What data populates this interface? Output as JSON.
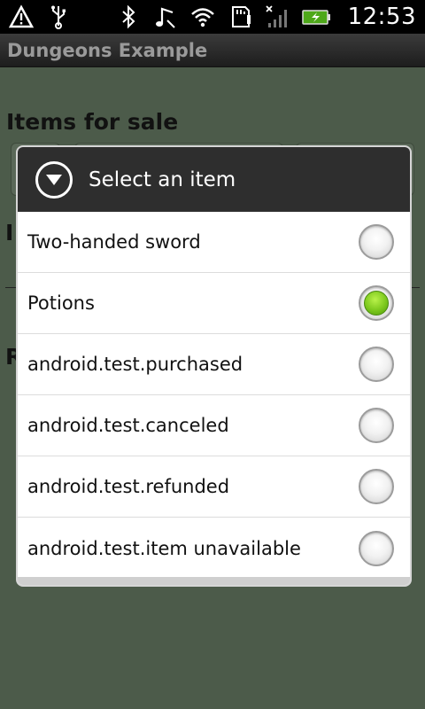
{
  "status_bar": {
    "icons_left": [
      "warning-icon",
      "usb-icon"
    ],
    "icons_right": [
      "bluetooth-icon",
      "music-icon",
      "wifi-icon",
      "sd-card-icon",
      "signal-icon",
      "battery-charging-icon"
    ],
    "time": "12:53"
  },
  "app": {
    "title": "Dungeons Example"
  },
  "background": {
    "heading": "Items for sale",
    "partial_letter_1": "I",
    "partial_letter_2": "R"
  },
  "dialog": {
    "title": "Select an item",
    "icon": "dropdown-circle-icon",
    "items": [
      {
        "label": "Two-handed sword",
        "selected": false
      },
      {
        "label": "Potions",
        "selected": true
      },
      {
        "label": "android.test.purchased",
        "selected": false
      },
      {
        "label": "android.test.canceled",
        "selected": false
      },
      {
        "label": "android.test.refunded",
        "selected": false
      },
      {
        "label": "android.test.item unavailable",
        "selected": false
      }
    ]
  },
  "colors": {
    "background": "#4c5b4a",
    "dialog_header": "#2e2e2e",
    "selected_radio": "#7cc81d"
  }
}
